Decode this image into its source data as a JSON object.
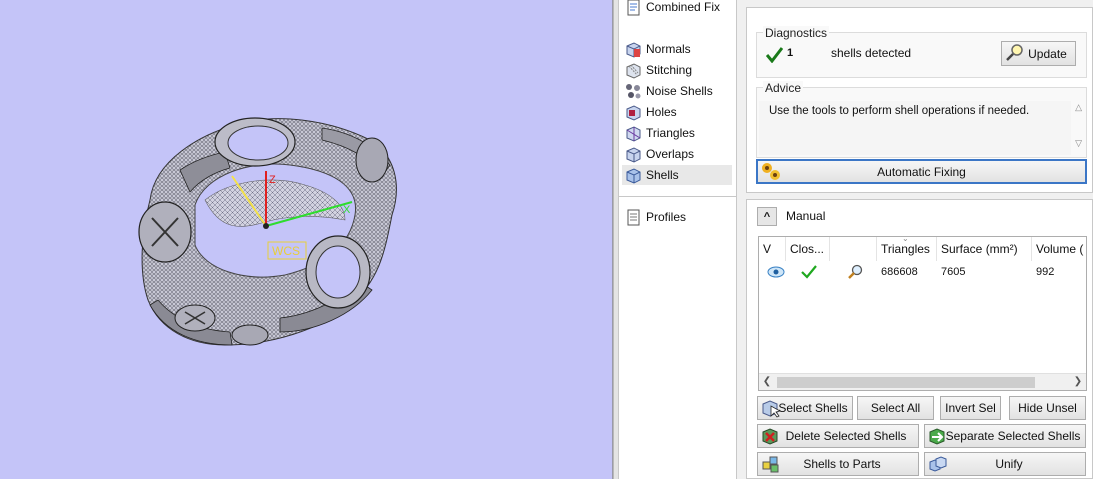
{
  "viewport": {
    "axes": {
      "z": "Z",
      "x": "X",
      "frame": "WCS"
    }
  },
  "tools": [
    {
      "label": "Combined Fix",
      "icon": "combined-fix-icon"
    },
    {
      "label": "Normals",
      "icon": "normals-icon"
    },
    {
      "label": "Stitching",
      "icon": "stitching-icon"
    },
    {
      "label": "Noise Shells",
      "icon": "noise-shells-icon"
    },
    {
      "label": "Holes",
      "icon": "holes-icon"
    },
    {
      "label": "Triangles",
      "icon": "triangles-icon"
    },
    {
      "label": "Overlaps",
      "icon": "overlaps-icon"
    },
    {
      "label": "Shells",
      "icon": "shells-icon",
      "selected": true
    },
    {
      "label": "Profiles",
      "icon": "profiles-icon"
    }
  ],
  "diagnostics": {
    "title": "Diagnostics",
    "count": "1",
    "text": "shells detected",
    "update_label": "Update"
  },
  "advice": {
    "title": "Advice",
    "text": "Use the tools to perform shell operations if needed."
  },
  "automatic_fixing_label": "Automatic Fixing",
  "manual": {
    "title": "Manual",
    "collapse_glyph": "^",
    "columns": [
      "V",
      "Clos...",
      "",
      "Triangles",
      "Surface (mm²)",
      "Volume ("
    ],
    "rows": [
      {
        "visible_icon": "eye-icon",
        "closed_icon": "check-icon",
        "zoom_icon": "magnifier-icon",
        "triangles": "686608",
        "surface": "7605",
        "volume": "992"
      }
    ],
    "buttons": {
      "select_shells": "Select Shells",
      "select_all": "Select All",
      "invert_sel": "Invert Sel",
      "hide_unsel": "Hide Unsel",
      "delete_selected": "Delete Selected Shells",
      "separate_selected": "Separate Selected Shells",
      "shells_to_parts": "Shells to Parts",
      "unify": "Unify"
    }
  },
  "colors": {
    "viewport_bg": "#c4c4f8",
    "accent": "#3b76c6",
    "check": "#1a9a1a"
  }
}
